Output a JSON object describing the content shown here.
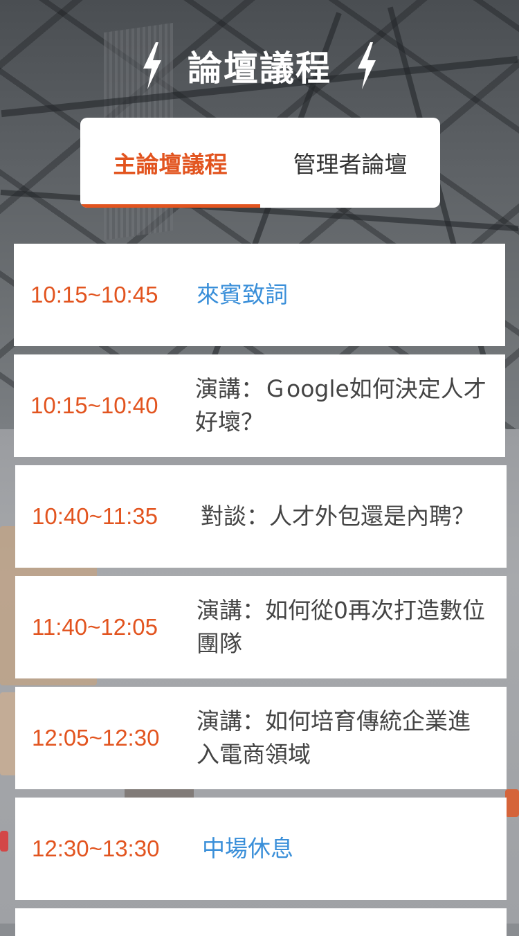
{
  "header": {
    "title": "論壇議程",
    "left_icon": "lightning-bolt-icon",
    "right_icon": "lightning-bolt-icon"
  },
  "tabs": [
    {
      "label": "主論壇議程",
      "active": true
    },
    {
      "label": "管理者論壇",
      "active": false
    }
  ],
  "colors": {
    "accent": "#e2541f",
    "link": "#3a8fd9",
    "text": "#444444",
    "card": "#ffffff"
  },
  "schedule": [
    {
      "time": "10:15~10:45",
      "topic": "來賓致詞",
      "highlight": true
    },
    {
      "time": "10:15~10:40",
      "topic": "演講：Ｇoogle如何決定人才好壞？",
      "highlight": false
    },
    {
      "time": "10:40~11:35",
      "topic": "對談：人才外包還是內聘？",
      "highlight": false
    },
    {
      "time": "11:40~12:05",
      "topic": "演講：如何從0再次打造數位團隊",
      "highlight": false
    },
    {
      "time": "12:05~12:30",
      "topic": "演講：如何培育傳統企業進入電商領域",
      "highlight": false
    },
    {
      "time": "12:30~13:30",
      "topic": "中場休息",
      "highlight": true
    }
  ]
}
